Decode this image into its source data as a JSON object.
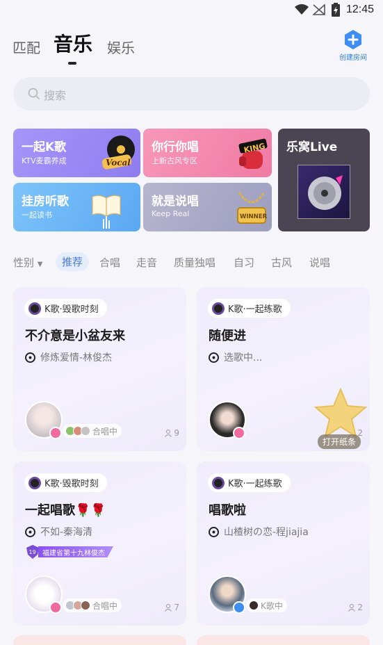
{
  "status_bar": {
    "time": "12:45"
  },
  "top_tabs": [
    {
      "label": "匹配",
      "active": false
    },
    {
      "label": "音乐",
      "active": true
    },
    {
      "label": "娱乐",
      "active": false
    }
  ],
  "create_room": {
    "label": "创建房间",
    "icon": "plus-icon"
  },
  "search": {
    "placeholder": "搜索",
    "icon": "search-icon"
  },
  "banners": [
    {
      "title": "一起K歌",
      "subtitle": "KTV麦霸养成",
      "art_text": "Vocal"
    },
    {
      "title": "你行你唱",
      "subtitle": "上新古风专区",
      "art_text": "KING"
    },
    {
      "title": "挂房听歌",
      "subtitle": "一起读书"
    },
    {
      "title": "就是说唱",
      "subtitle": "Keep Real",
      "art_text": "WINNER"
    },
    {
      "title": "乐窝Live"
    }
  ],
  "filters": {
    "gender_label": "性别",
    "items": [
      "推荐",
      "合唱",
      "走音",
      "质量独唱",
      "自习",
      "古风",
      "说唱"
    ],
    "active": "推荐"
  },
  "rooms": [
    {
      "tag": "K歌·毁歌时刻",
      "title": "不介意是小盆友来",
      "song": "修炼爱情-林俊杰",
      "status": "合唱中",
      "count": "9"
    },
    {
      "tag": "K歌·一起练歌",
      "title": "随便进",
      "song": "选歌中...",
      "status": "",
      "count": "2"
    },
    {
      "tag": "K歌·毁歌时刻",
      "title": "一起唱歌🌹🌹",
      "song": "不如-秦海清",
      "badge_level": "19",
      "badge_text": "福建省第十九林俊杰",
      "status": "合唱中",
      "count": "7"
    },
    {
      "tag": "K歌·一起练歌",
      "title": "唱歌啦",
      "song": "山楂树の恋-程jiajia",
      "status": "K歌中",
      "count": "2"
    }
  ],
  "floating_star": {
    "label": "打开纸条"
  },
  "colors": {
    "accent": "#4a7bd8",
    "create_blue": "#2a7de1",
    "badge_pink": "#f06aa0"
  }
}
